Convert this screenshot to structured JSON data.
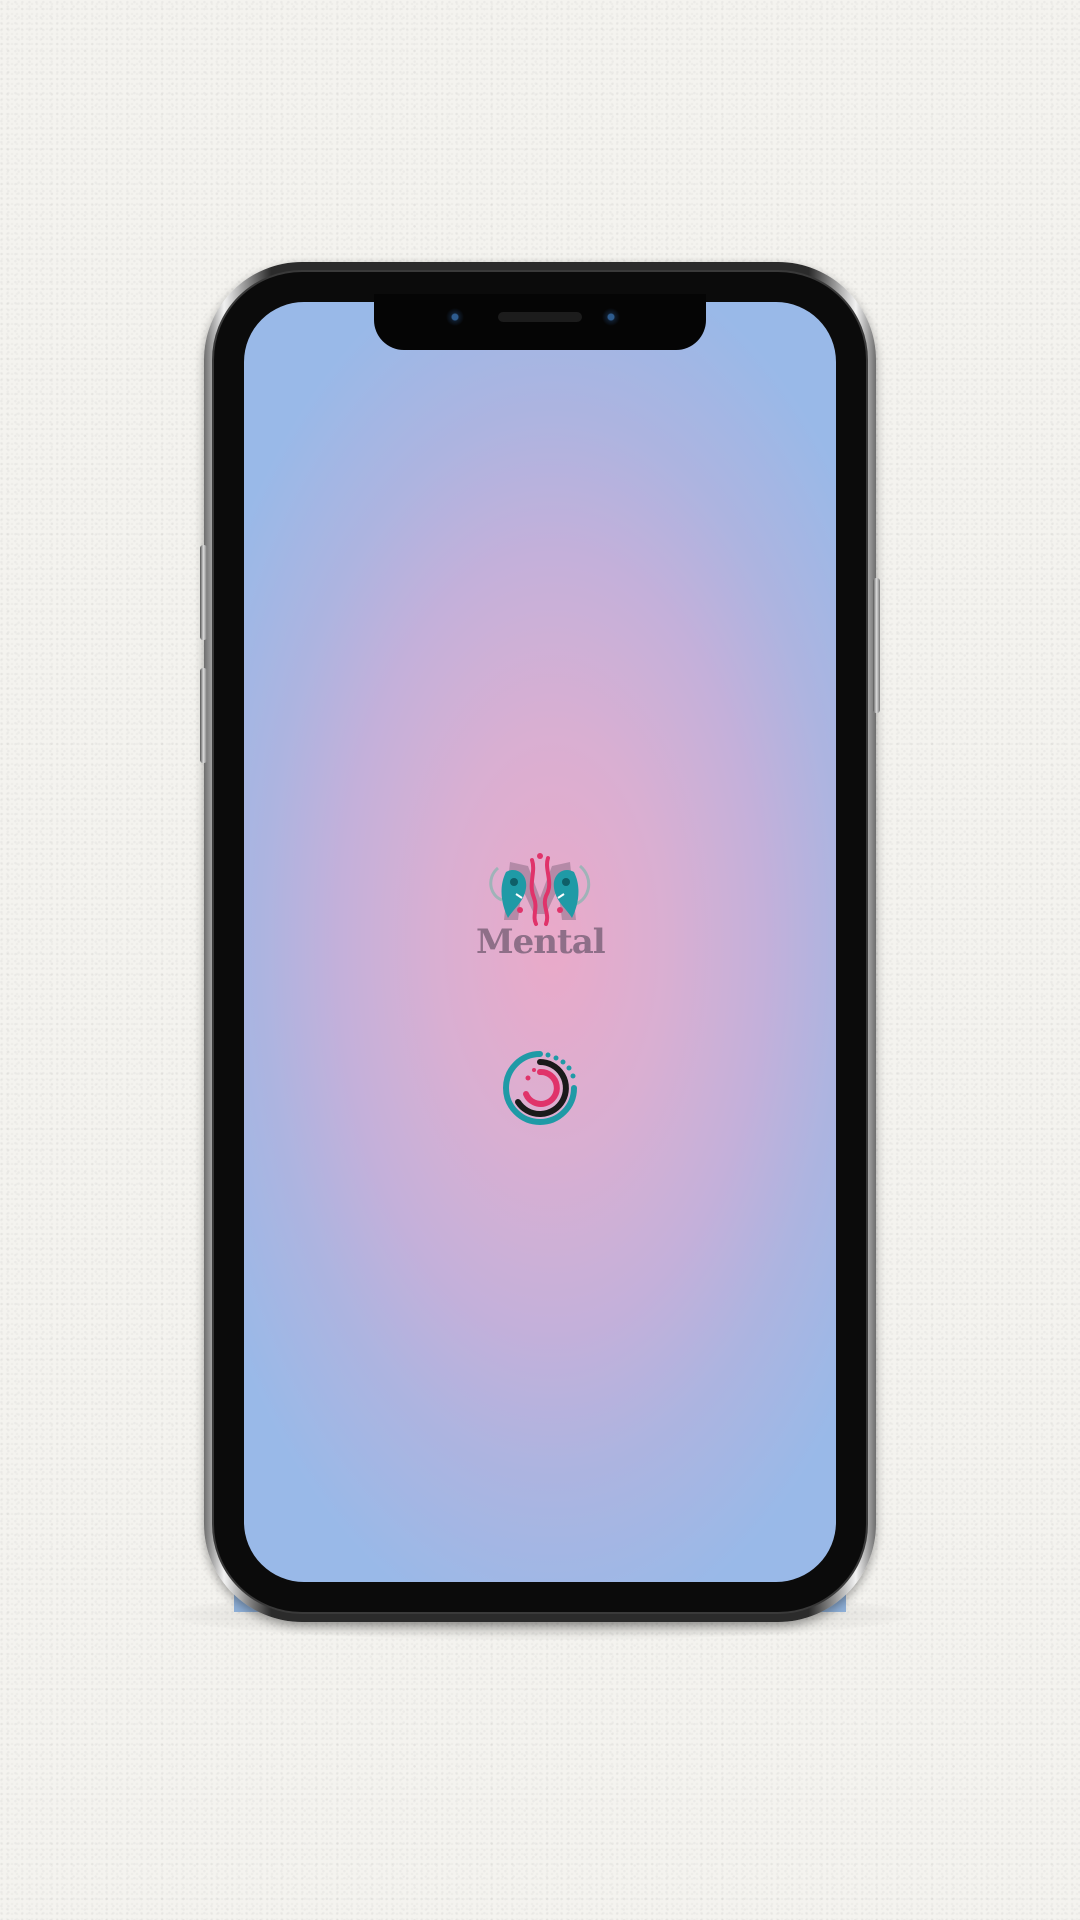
{
  "app": {
    "name": "Mental"
  },
  "splash": {
    "logo_text": "Mental",
    "loading": true
  },
  "colors": {
    "screen_center": "#eaaac9",
    "screen_edge": "#99b9e8",
    "logo_text": "#8e6f88",
    "accent_teal": "#1f9aa6",
    "accent_pink": "#e0336a",
    "loader_dark": "#1a1a1a"
  },
  "icons": {
    "logo": "mental-logo-icon",
    "loader": "loading-spinner-icon"
  }
}
